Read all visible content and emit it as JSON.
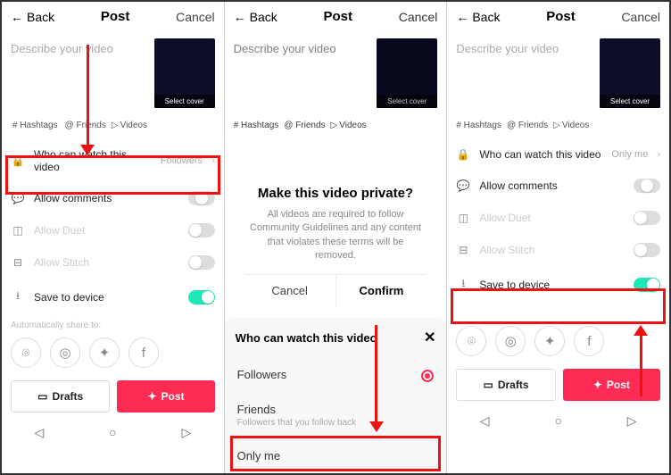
{
  "header": {
    "back": "Back",
    "title": "Post",
    "cancel": "Cancel"
  },
  "desc_placeholder": "Describe your video",
  "thumb_label": "Select cover",
  "tags": {
    "hashtags": "# Hashtags",
    "friends": "@ Friends",
    "videos": "Videos"
  },
  "options": {
    "who": "Who can watch this video",
    "who_val_followers": "Followers",
    "who_val_onlyme": "Only me",
    "allow_comments": "Allow comments",
    "allow_duet": "Allow Duet",
    "allow_stitch": "Allow Stitch",
    "save_device": "Save to device"
  },
  "auto_share": "Automatically share to:",
  "buttons": {
    "drafts": "Drafts",
    "post": "Post"
  },
  "dialog": {
    "title": "Make this video private?",
    "body": "All videos are required to follow Community Guidelines and any content that violates these terms will be removed.",
    "cancel": "Cancel",
    "confirm": "Confirm"
  },
  "sheet": {
    "title": "Who can watch this video",
    "followers": "Followers",
    "friends": "Friends",
    "friends_sub": "Followers that you follow back",
    "only_me": "Only me"
  }
}
